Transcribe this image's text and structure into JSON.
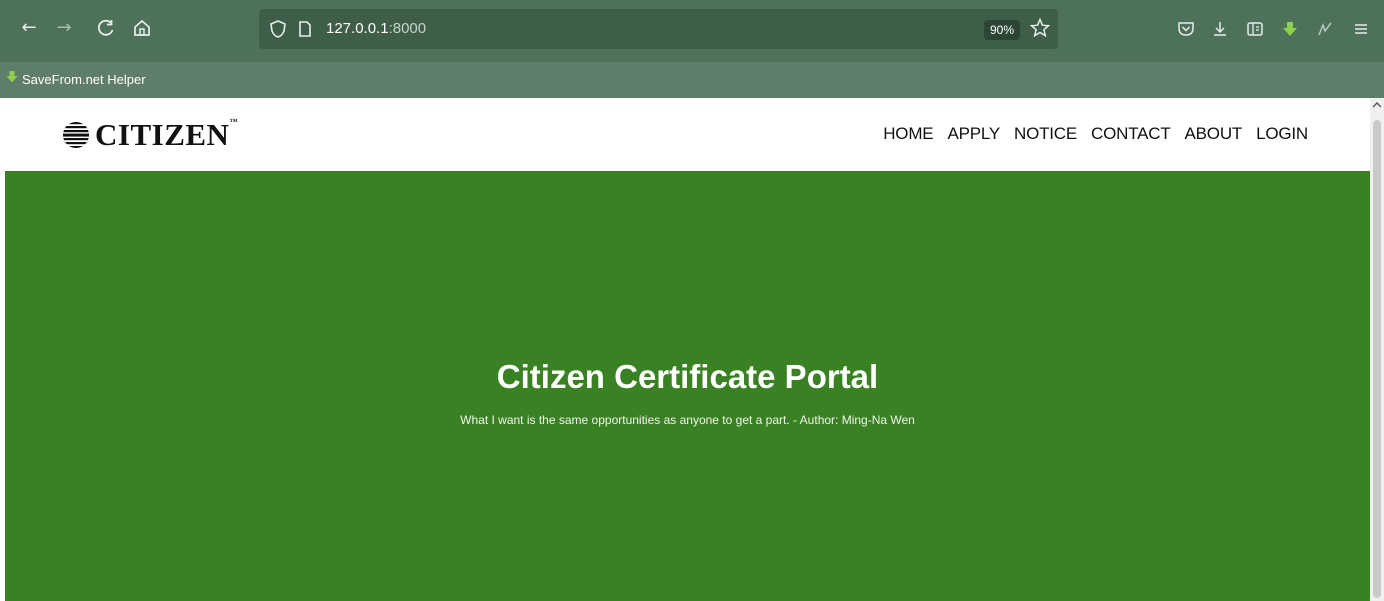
{
  "browser": {
    "back_icon": "←",
    "forward_icon": "→",
    "reload_icon": "C",
    "home_icon": "⌂",
    "url_host": "127.0.0.1",
    "url_port": ":8000",
    "zoom": "90%",
    "bookmark_label": "SaveFrom.net Helper",
    "colors": {
      "toolbar": "#4e7159",
      "urlbar": "#3e5e48",
      "bookmarks_bar": "#5f7e69"
    }
  },
  "site": {
    "logo_text": "CITIZEN",
    "logo_tm": "™",
    "nav": [
      "HOME",
      "APPLY",
      "NOTICE",
      "CONTACT",
      "ABOUT",
      "LOGIN"
    ]
  },
  "hero": {
    "title": "Citizen Certificate Portal",
    "quote": "What I want is the same opportunities as anyone to get a part. - Author: Ming-Na Wen",
    "background": "#3a8124"
  }
}
